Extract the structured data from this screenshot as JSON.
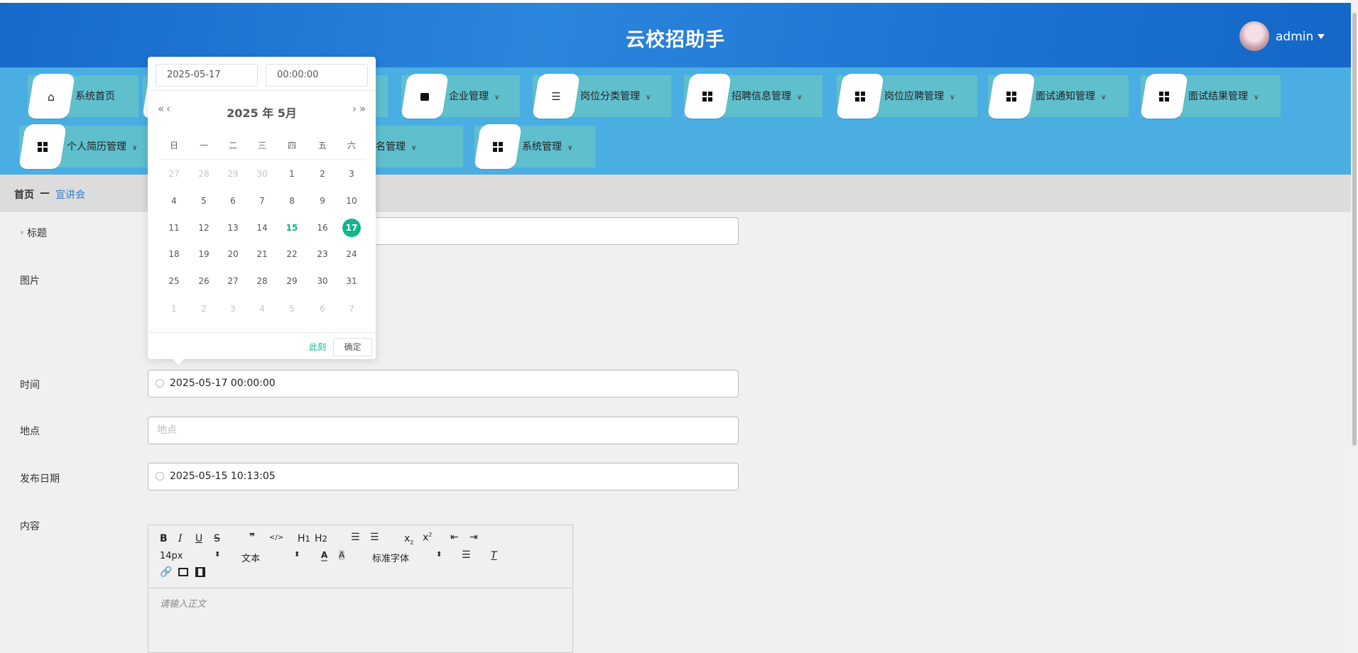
{
  "header": {
    "title": "云校招助手",
    "user": "admin"
  },
  "nav": {
    "row1": [
      {
        "label": "系统首页",
        "icon": "home-icon",
        "chev": false
      },
      {
        "label": "",
        "icon": "grid-icon",
        "chev": false
      },
      {
        "label": "",
        "icon": "grid-icon",
        "chev": false
      },
      {
        "label": "企业管理",
        "icon": "store-icon",
        "chev": true
      },
      {
        "label": "岗位分类管理",
        "icon": "sliders-icon",
        "chev": true
      },
      {
        "label": "招聘信息管理",
        "icon": "grid-icon",
        "chev": true
      },
      {
        "label": "岗位应聘管理",
        "icon": "grid-icon",
        "chev": true
      },
      {
        "label": "面试通知管理",
        "icon": "grid-icon",
        "chev": true
      },
      {
        "label": "面试结果管理",
        "icon": "grid-icon",
        "chev": true
      }
    ],
    "row2": [
      {
        "label": "个人简历管理",
        "icon": "grid-icon",
        "chev": true
      },
      {
        "label": "",
        "icon": "grid-icon",
        "chev": false
      },
      {
        "label": "讲会报名管理",
        "icon": "grid-icon",
        "chev": true
      },
      {
        "label": "系统管理",
        "icon": "grid-icon",
        "chev": true
      }
    ]
  },
  "breadcrumb": {
    "home": "首页",
    "sep": "—",
    "current": "宣讲会"
  },
  "form": {
    "title_label": "标题",
    "required_mark": "*",
    "image_label": "图片",
    "time_label": "时间",
    "time_value": "2025-05-17 00:00:00",
    "place_label": "地点",
    "place_placeholder": "地点",
    "pub_label": "发布日期",
    "pub_value": "2025-05-15 10:13:05",
    "content_label": "内容",
    "content_placeholder": "请输入正文"
  },
  "editor": {
    "size": "14px",
    "header": "文本",
    "font": "标准字体"
  },
  "picker": {
    "date": "2025-05-17",
    "time": "00:00:00",
    "month_title": "2025 年  5月",
    "weekdays": [
      "日",
      "一",
      "二",
      "三",
      "四",
      "五",
      "六"
    ],
    "today": 15,
    "selected": 17,
    "weeks": [
      [
        [
          27,
          1
        ],
        [
          28,
          1
        ],
        [
          29,
          1
        ],
        [
          30,
          1
        ],
        [
          1,
          0
        ],
        [
          2,
          0
        ],
        [
          3,
          0
        ]
      ],
      [
        [
          4,
          0
        ],
        [
          5,
          0
        ],
        [
          6,
          0
        ],
        [
          7,
          0
        ],
        [
          8,
          0
        ],
        [
          9,
          0
        ],
        [
          10,
          0
        ]
      ],
      [
        [
          11,
          0
        ],
        [
          12,
          0
        ],
        [
          13,
          0
        ],
        [
          14,
          0
        ],
        [
          15,
          0
        ],
        [
          16,
          0
        ],
        [
          17,
          0
        ]
      ],
      [
        [
          18,
          0
        ],
        [
          19,
          0
        ],
        [
          20,
          0
        ],
        [
          21,
          0
        ],
        [
          22,
          0
        ],
        [
          23,
          0
        ],
        [
          24,
          0
        ]
      ],
      [
        [
          25,
          0
        ],
        [
          26,
          0
        ],
        [
          27,
          0
        ],
        [
          28,
          0
        ],
        [
          29,
          0
        ],
        [
          30,
          0
        ],
        [
          31,
          0
        ]
      ],
      [
        [
          1,
          1
        ],
        [
          2,
          1
        ],
        [
          3,
          1
        ],
        [
          4,
          1
        ],
        [
          5,
          1
        ],
        [
          6,
          1
        ],
        [
          7,
          1
        ]
      ]
    ],
    "now_label": "此刻",
    "ok_label": "确定"
  },
  "colors": {
    "accent": "#13b58a",
    "header": "#1e74d2",
    "nav": "#4aaee2",
    "nav_item": "#5fbfcd"
  }
}
